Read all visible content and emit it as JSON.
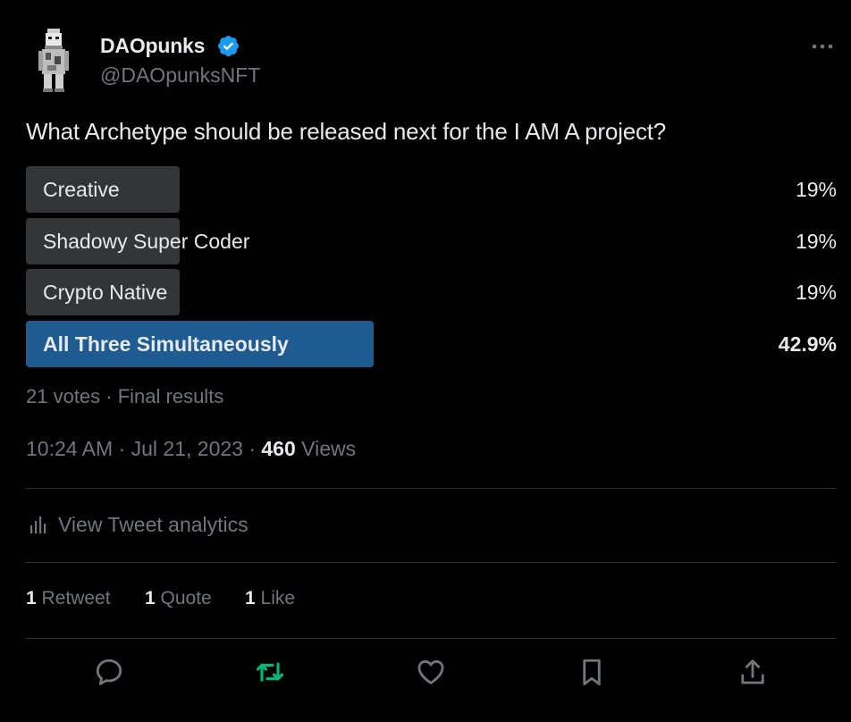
{
  "author": {
    "name": "DAOpunks",
    "handle": "@DAOpunksNFT",
    "verified": true
  },
  "tweet": {
    "text": "What Archetype should be released next for the I AM A project?"
  },
  "poll": {
    "options": [
      {
        "label": "Creative",
        "percent": "19%",
        "fraction": 0.19,
        "winner": false
      },
      {
        "label": "Shadowy Super Coder",
        "percent": "19%",
        "fraction": 0.19,
        "winner": false
      },
      {
        "label": "Crypto Native",
        "percent": "19%",
        "fraction": 0.19,
        "winner": false
      },
      {
        "label": "All Three Simultaneously",
        "percent": "42.9%",
        "fraction": 0.429,
        "winner": true
      }
    ],
    "meta": "21 votes · Final results"
  },
  "timestamp": {
    "time_date": "10:24 AM · Jul 21, 2023 · ",
    "views_count": "460",
    "views_label": " Views"
  },
  "analytics": {
    "label": "View Tweet analytics"
  },
  "stats": {
    "retweets_count": "1",
    "retweets_label": "Retweet",
    "quotes_count": "1",
    "quotes_label": "Quote",
    "likes_count": "1",
    "likes_label": "Like"
  },
  "actions": {
    "reply_icon": "reply-icon",
    "retweet_icon": "retweet-icon",
    "like_icon": "heart-icon",
    "bookmark_icon": "bookmark-icon",
    "share_icon": "share-icon",
    "retweet_active_color": "#00ba7c",
    "icon_color": "#71767b"
  },
  "colors": {
    "verified": "#1d9bf0",
    "poll_bar": "#333639",
    "poll_winner_bar": "#1d5b91"
  }
}
